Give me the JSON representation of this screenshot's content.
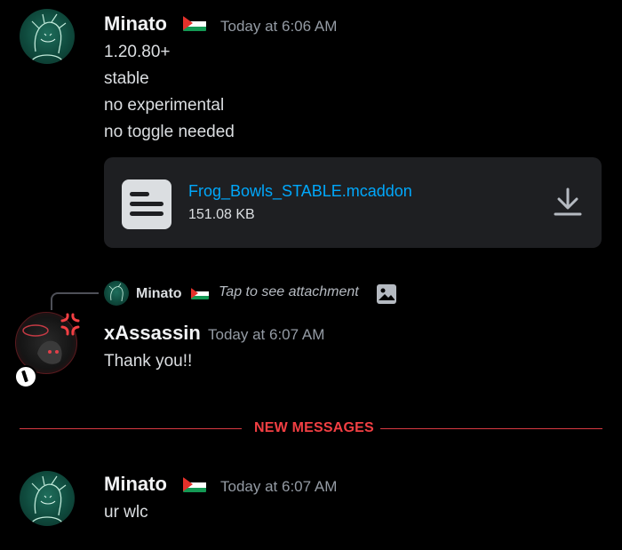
{
  "colors": {
    "background": "#000000",
    "link": "#00a8fc",
    "new_messages": "#f23f43",
    "timestamp": "#949ba4",
    "attachment_bg": "#1e1f22"
  },
  "messages": [
    {
      "author": "Minato",
      "flag_icon": "palestine-flag-icon",
      "timestamp": "Today at 6:06 AM",
      "lines": [
        "1.20.80+",
        "stable",
        "no experimental",
        "no toggle needed"
      ],
      "attachment": {
        "icon": "file-icon",
        "filename": "Frog_Bowls_STABLE.mcaddon",
        "size": "151.08 KB",
        "download_icon": "download-icon"
      }
    },
    {
      "reply": {
        "author": "Minato",
        "text": "Tap to see attachment",
        "icon": "image-icon"
      },
      "author": "xAssassin",
      "timestamp": "Today at 6:07 AM",
      "lines": [
        "Thank you!!"
      ]
    },
    {
      "author": "Minato",
      "flag_icon": "palestine-flag-icon",
      "timestamp": "Today at 6:07 AM",
      "lines": [
        "ur wlc"
      ]
    }
  ],
  "divider": {
    "label": "NEW MESSAGES"
  }
}
